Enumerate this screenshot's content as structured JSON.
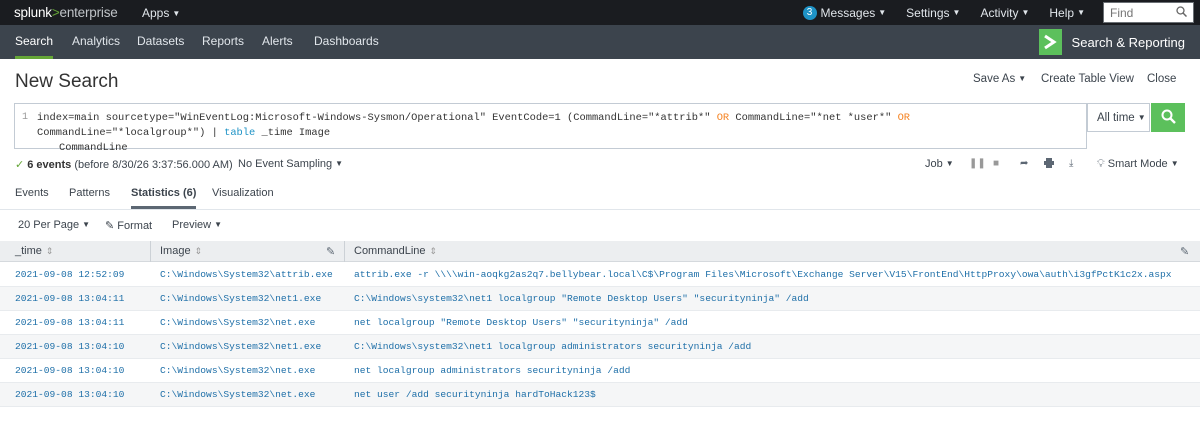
{
  "topbar": {
    "logo_splunk": "splunk",
    "logo_gt": ">",
    "logo_enterprise": "enterprise",
    "apps_label": "Apps",
    "messages_count": "3",
    "messages_label": "Messages",
    "settings_label": "Settings",
    "activity_label": "Activity",
    "help_label": "Help",
    "find_placeholder": "Find"
  },
  "appbar": {
    "nav": [
      "Search",
      "Analytics",
      "Datasets",
      "Reports",
      "Alerts",
      "Dashboards"
    ],
    "app_name": "Search & Reporting"
  },
  "page": {
    "title": "New Search",
    "save_as": "Save As",
    "create_table_view": "Create Table View",
    "close": "Close"
  },
  "search": {
    "line_number": "1",
    "q1": "index=main sourcetype=\"WinEventLog:Microsoft-Windows-Sysmon/Operational\" EventCode=1 (CommandLine=\"*attrib*\"",
    "q_or1": "OR",
    "q2": "CommandLine=\"*net *user*\"",
    "q_or2": "OR",
    "q3": "CommandLine=\"*localgroup*\") |",
    "q_table": "table",
    "q4": "_time Image",
    "q5": "CommandLine",
    "time_range": "All time"
  },
  "status": {
    "events_count": "6 events",
    "events_detail": "(before 8/30/26 3:37:56.000 AM)",
    "sampling": "No Event Sampling",
    "job": "Job",
    "mode": "Smart Mode"
  },
  "tabs": {
    "events": "Events",
    "patterns": "Patterns",
    "statistics": "Statistics (6)",
    "visualization": "Visualization"
  },
  "toolbar": {
    "per_page": "20 Per Page",
    "format": "Format",
    "preview": "Preview"
  },
  "table": {
    "columns": [
      "_time",
      "Image",
      "CommandLine"
    ],
    "rows": [
      {
        "time": "2021-09-08 12:52:09",
        "image": "C:\\Windows\\System32\\attrib.exe",
        "cmd": "attrib.exe  -r \\\\\\\\win-aoqkg2as2q7.bellybear.local\\C$\\Program Files\\Microsoft\\Exchange Server\\V15\\FrontEnd\\HttpProxy\\owa\\auth\\i3gfPctK1c2x.aspx"
      },
      {
        "time": "2021-09-08 13:04:11",
        "image": "C:\\Windows\\System32\\net1.exe",
        "cmd": "C:\\Windows\\system32\\net1  localgroup \"Remote Desktop Users\" \"securityninja\" /add"
      },
      {
        "time": "2021-09-08 13:04:11",
        "image": "C:\\Windows\\System32\\net.exe",
        "cmd": "net  localgroup \"Remote Desktop Users\" \"securityninja\" /add"
      },
      {
        "time": "2021-09-08 13:04:10",
        "image": "C:\\Windows\\System32\\net1.exe",
        "cmd": "C:\\Windows\\system32\\net1  localgroup administrators securityninja  /add"
      },
      {
        "time": "2021-09-08 13:04:10",
        "image": "C:\\Windows\\System32\\net.exe",
        "cmd": "net  localgroup administrators securityninja  /add"
      },
      {
        "time": "2021-09-08 13:04:10",
        "image": "C:\\Windows\\System32\\net.exe",
        "cmd": "net  user /add securityninja hardToHack123$"
      }
    ]
  },
  "colors": {
    "accent_green": "#65a637",
    "link_blue": "#1e6fa8",
    "topbar_bg": "#1a1c20",
    "appbar_bg": "#3c444d"
  }
}
